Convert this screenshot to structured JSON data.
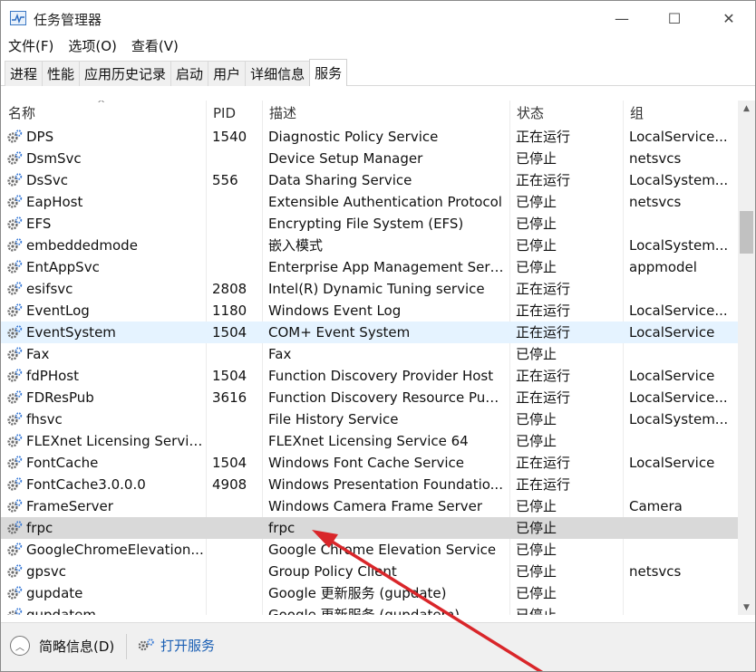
{
  "window": {
    "title": "任务管理器",
    "controls": {
      "minimize": "—",
      "maximize": "☐",
      "close": "✕"
    }
  },
  "menu": [
    "文件(F)",
    "选项(O)",
    "查看(V)"
  ],
  "tabs": [
    "进程",
    "性能",
    "应用历史记录",
    "启动",
    "用户",
    "详细信息",
    "服务"
  ],
  "active_tab": "服务",
  "columns": {
    "name": "名称",
    "pid": "PID",
    "desc": "描述",
    "status": "状态",
    "group": "组"
  },
  "rows": [
    {
      "name": "DPS",
      "pid": "1540",
      "desc": "Diagnostic Policy Service",
      "status": "正在运行",
      "group": "LocalService..."
    },
    {
      "name": "DsmSvc",
      "pid": "",
      "desc": "Device Setup Manager",
      "status": "已停止",
      "group": "netsvcs"
    },
    {
      "name": "DsSvc",
      "pid": "556",
      "desc": "Data Sharing Service",
      "status": "正在运行",
      "group": "LocalSystem..."
    },
    {
      "name": "EapHost",
      "pid": "",
      "desc": "Extensible Authentication Protocol",
      "status": "已停止",
      "group": "netsvcs"
    },
    {
      "name": "EFS",
      "pid": "",
      "desc": "Encrypting File System (EFS)",
      "status": "已停止",
      "group": ""
    },
    {
      "name": "embeddedmode",
      "pid": "",
      "desc": "嵌入模式",
      "status": "已停止",
      "group": "LocalSystem..."
    },
    {
      "name": "EntAppSvc",
      "pid": "",
      "desc": "Enterprise App Management Serv...",
      "status": "已停止",
      "group": "appmodel"
    },
    {
      "name": "esifsvc",
      "pid": "2808",
      "desc": "Intel(R) Dynamic Tuning service",
      "status": "正在运行",
      "group": ""
    },
    {
      "name": "EventLog",
      "pid": "1180",
      "desc": "Windows Event Log",
      "status": "正在运行",
      "group": "LocalService..."
    },
    {
      "name": "EventSystem",
      "pid": "1504",
      "desc": "COM+ Event System",
      "status": "正在运行",
      "group": "LocalService"
    },
    {
      "name": "Fax",
      "pid": "",
      "desc": "Fax",
      "status": "已停止",
      "group": ""
    },
    {
      "name": "fdPHost",
      "pid": "1504",
      "desc": "Function Discovery Provider Host",
      "status": "正在运行",
      "group": "LocalService"
    },
    {
      "name": "FDResPub",
      "pid": "3616",
      "desc": "Function Discovery Resource Publ...",
      "status": "正在运行",
      "group": "LocalService..."
    },
    {
      "name": "fhsvc",
      "pid": "",
      "desc": "File History Service",
      "status": "已停止",
      "group": "LocalSystem..."
    },
    {
      "name": "FLEXnet Licensing Servic...",
      "pid": "",
      "desc": "FLEXnet Licensing Service 64",
      "status": "已停止",
      "group": ""
    },
    {
      "name": "FontCache",
      "pid": "1504",
      "desc": "Windows Font Cache Service",
      "status": "正在运行",
      "group": "LocalService"
    },
    {
      "name": "FontCache3.0.0.0",
      "pid": "4908",
      "desc": "Windows Presentation Foundatio...",
      "status": "正在运行",
      "group": ""
    },
    {
      "name": "FrameServer",
      "pid": "",
      "desc": "Windows Camera Frame Server",
      "status": "已停止",
      "group": "Camera"
    },
    {
      "name": "frpc",
      "pid": "",
      "desc": "frpc",
      "status": "已停止",
      "group": ""
    },
    {
      "name": "GoogleChromeElevation...",
      "pid": "",
      "desc": "Google Chrome Elevation Service",
      "status": "已停止",
      "group": ""
    },
    {
      "name": "gpsvc",
      "pid": "",
      "desc": "Group Policy Client",
      "status": "已停止",
      "group": "netsvcs"
    },
    {
      "name": "gupdate",
      "pid": "",
      "desc": "Google 更新服务 (gupdate)",
      "status": "已停止",
      "group": ""
    },
    {
      "name": "gupdatem",
      "pid": "",
      "desc": "Google 更新服务 (gupdatem)",
      "status": "已停止",
      "group": ""
    }
  ],
  "footer": {
    "fewer_details": "简略信息(D)",
    "open_services": "打开服务"
  },
  "colors": {
    "selected_row": "#d9d9d9",
    "hover_row": "#e5f3ff",
    "link": "#1a5fb4",
    "annotation_arrow": "#d9262a"
  }
}
